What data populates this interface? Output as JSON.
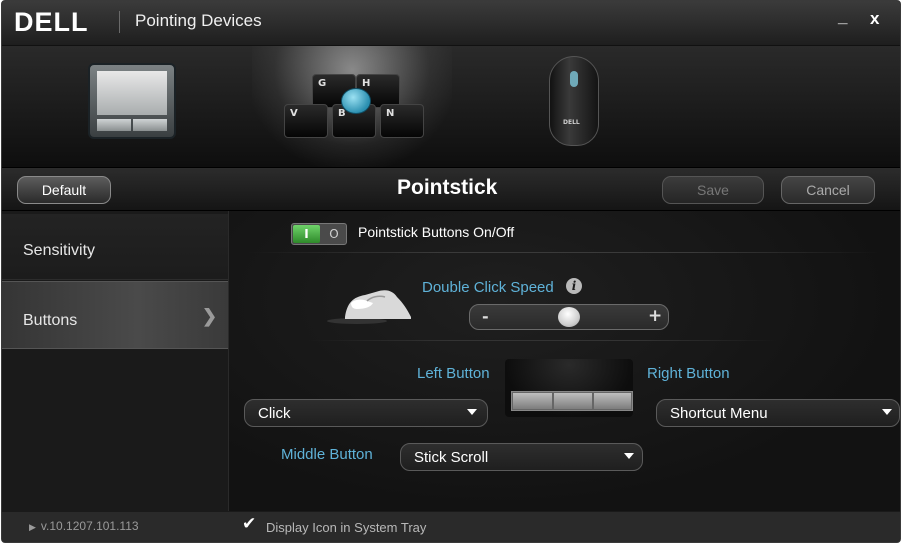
{
  "titlebar": {
    "logo": "DELL",
    "title": "Pointing Devices",
    "minimize": "_",
    "close": "x"
  },
  "devices": {
    "keyboard_keys": [
      "G",
      "H",
      "V",
      "B",
      "N"
    ],
    "mouse_logo": "DELL"
  },
  "header": {
    "default_label": "Default",
    "title": "Pointstick",
    "save_label": "Save",
    "cancel_label": "Cancel"
  },
  "sidebar": {
    "items": [
      {
        "label": "Sensitivity"
      },
      {
        "label": "Buttons"
      }
    ]
  },
  "main": {
    "toggle_on": "I",
    "toggle_off": "O",
    "toggle_label": "Pointstick Buttons On/Off",
    "double_click_label": "Double Click Speed",
    "info_glyph": "i",
    "slider_minus": "-",
    "slider_plus": "+",
    "slider_value_fraction": 0.5,
    "left_button_label": "Left Button",
    "right_button_label": "Right Button",
    "middle_button_label": "Middle Button",
    "left_button_value": "Click",
    "right_button_value": "Shortcut Menu",
    "middle_button_value": "Stick Scroll"
  },
  "footer": {
    "version": "v.10.1207.101.113",
    "tray_checked": true,
    "tray_label": "Display Icon in System Tray"
  },
  "colors": {
    "accent_blue": "#5fb2d8",
    "toggle_green": "#3aa136",
    "background": "#1b1b1b"
  }
}
